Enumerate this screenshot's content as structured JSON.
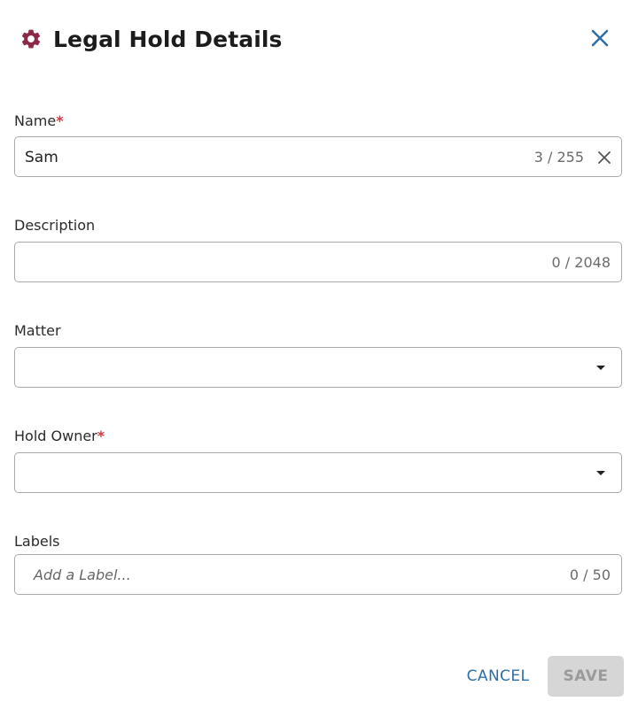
{
  "dialog": {
    "title": "Legal Hold Details",
    "title_icon": "gear-icon",
    "close_icon": "close-icon"
  },
  "fields": {
    "name": {
      "label": "Name",
      "required_mark": "*",
      "value": "Sam",
      "counter": "3 / 255"
    },
    "description": {
      "label": "Description",
      "value": "",
      "counter": "0 / 2048"
    },
    "matter": {
      "label": "Matter",
      "selected": ""
    },
    "hold_owner": {
      "label": "Hold Owner",
      "required_mark": "*",
      "selected": ""
    },
    "labels": {
      "label": "Labels",
      "placeholder": "Add a Label...",
      "counter": "0 / 50"
    }
  },
  "actions": {
    "cancel_label": "CANCEL",
    "save_label": "SAVE"
  },
  "colors": {
    "gear": "#8b2a46",
    "close": "#2f6fa8",
    "required": "#d9363e",
    "cancel": "#2f6fa8",
    "save_disabled_bg": "#d6d6d6"
  }
}
